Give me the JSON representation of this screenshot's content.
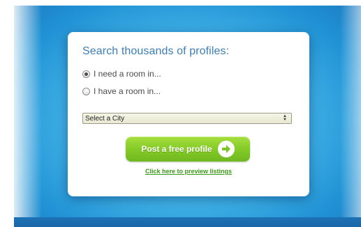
{
  "search_card": {
    "title": "Search thousands of profiles:",
    "options": [
      {
        "label": "I need a room in...",
        "checked": true
      },
      {
        "label": "I have a room in...",
        "checked": false
      }
    ],
    "city_select": {
      "value": "Select a City"
    },
    "post_button": {
      "label": "Post a free profile",
      "icon": "arrow-right-icon"
    },
    "preview_link": "Click here to preview listings"
  },
  "colors": {
    "title": "#3b7fb5",
    "button_green": "#85cb28",
    "link_green": "#3b9a18",
    "background_blue": "#45b6e8"
  }
}
